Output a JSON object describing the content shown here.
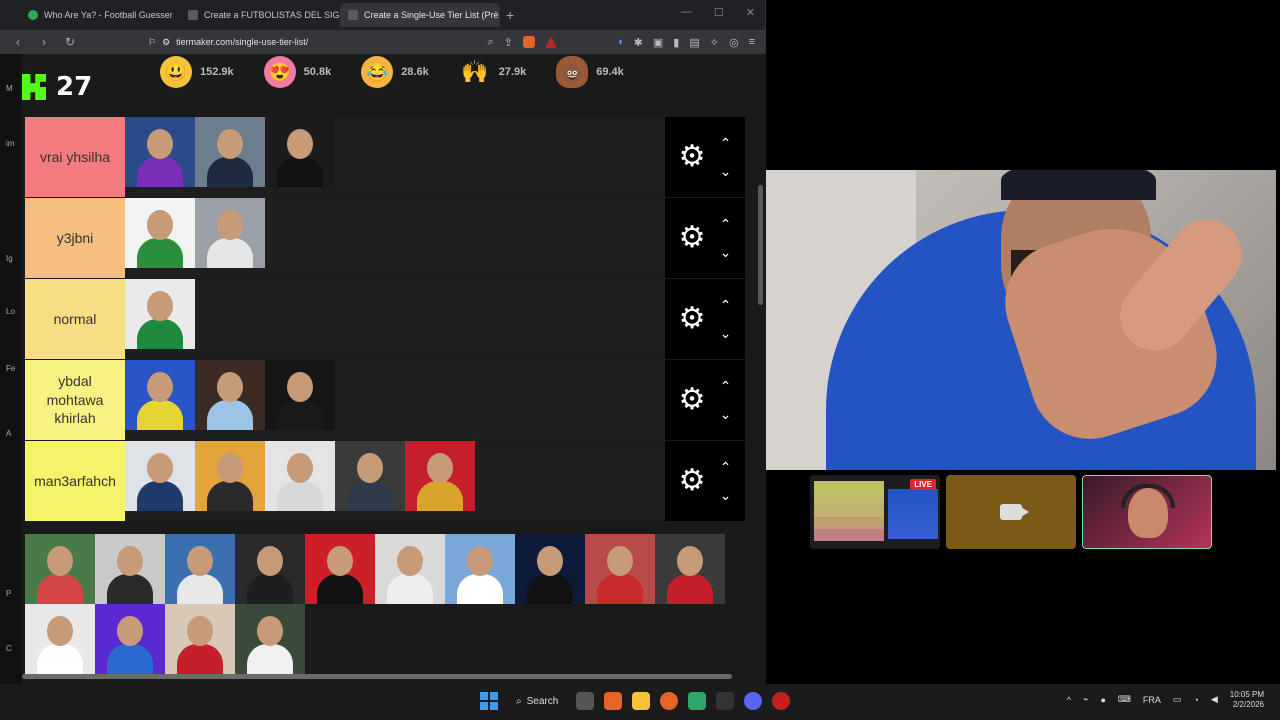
{
  "browser": {
    "tabs": [
      {
        "title": "Who Are Ya? - Football Guesser",
        "active": false
      },
      {
        "title": "Create a FUTBOLISTAS DEL SIGLO Ti",
        "active": false
      },
      {
        "title": "Create a Single-Use Tier List (Prè",
        "active": true
      }
    ],
    "url": "tiermaker.com/single-use-tier-list/"
  },
  "kick": {
    "count": "27"
  },
  "reactions": [
    {
      "icon": "grin-emoji-icon",
      "glyph": "😃",
      "count": "152.9k"
    },
    {
      "icon": "heart-eyes-emoji-icon",
      "glyph": "😍",
      "count": "50.8k"
    },
    {
      "icon": "laughing-emoji-icon",
      "glyph": "😂",
      "count": "28.6k"
    },
    {
      "icon": "raised-hands-emoji-icon",
      "glyph": "🙌",
      "count": "27.9k"
    },
    {
      "icon": "poop-emoji-icon",
      "glyph": "💩",
      "count": "69.4k"
    }
  ],
  "tiers": [
    {
      "label": "vrai yhsilha",
      "color": "#f47c80",
      "items": [
        {
          "bg": "#2a4a8a",
          "shirt": "#7a2fb5"
        },
        {
          "bg": "#6d7f8f",
          "shirt": "#1e2a3d"
        },
        {
          "bg": "#1c1c1c",
          "shirt": "#111111"
        }
      ]
    },
    {
      "label": "y3jbni",
      "color": "#f7be81",
      "items": [
        {
          "bg": "#f2f2f2",
          "shirt": "#2a8f3a"
        },
        {
          "bg": "#9aa0a6",
          "shirt": "#e6e6e6"
        }
      ]
    },
    {
      "label": "normal",
      "color": "#f7dd84",
      "items": [
        {
          "bg": "#eaeaea",
          "shirt": "#1f8a3d"
        }
      ]
    },
    {
      "label": "ybdal mohtawa khirlah",
      "color": "#f7f383",
      "items": [
        {
          "bg": "#2a55c9",
          "shirt": "#e4d534"
        },
        {
          "bg": "#3b2b24",
          "shirt": "#9cc4e6"
        },
        {
          "bg": "#161616",
          "shirt": "#1a1a1a"
        }
      ]
    },
    {
      "label": "man3arfahch",
      "color": "#f4f36a",
      "items": [
        {
          "bg": "#dfe3e8",
          "shirt": "#1f3a6a"
        },
        {
          "bg": "#e3a53a",
          "shirt": "#2a2a2a"
        },
        {
          "bg": "#e4e4e4",
          "shirt": "#d8d8d8"
        },
        {
          "bg": "#3a3a3a",
          "shirt": "#2f3a4a"
        },
        {
          "bg": "#c41f2a",
          "shirt": "#d8a52a"
        }
      ]
    }
  ],
  "pool": [
    {
      "bg": "#4a7a4a",
      "shirt": "#d64545"
    },
    {
      "bg": "#c9c9c9",
      "shirt": "#2a2a2a"
    },
    {
      "bg": "#3a6fb0",
      "shirt": "#e8e8e8"
    },
    {
      "bg": "#2a2a2a",
      "shirt": "#1e1e1e"
    },
    {
      "bg": "#cc1f28",
      "shirt": "#111111"
    },
    {
      "bg": "#d9d9d9",
      "shirt": "#eeeeee"
    },
    {
      "bg": "#7aa8d8",
      "shirt": "#ffffff"
    },
    {
      "bg": "#0e1a3a",
      "shirt": "#111111"
    },
    {
      "bg": "#b84a4a",
      "shirt": "#c82a2a"
    },
    {
      "bg": "#3a3a3a",
      "shirt": "#c21f2a"
    },
    {
      "bg": "#e8e8e8",
      "shirt": "#ffffff"
    },
    {
      "bg": "#5a2ad0",
      "shirt": "#2a6ad0"
    },
    {
      "bg": "#d8c8b8",
      "shirt": "#c21f2a"
    },
    {
      "bg": "#3a4a3a",
      "shirt": "#f0f0f0"
    }
  ],
  "participants": {
    "live_badge": "LIVE"
  },
  "taskbar": {
    "search": "Search",
    "lang": "FRA",
    "time": "10:05 PM",
    "date": "2/2/2026"
  },
  "left_edge": [
    "M",
    "im",
    "Ig",
    "Lo",
    "Fe",
    "A",
    "P",
    "C"
  ]
}
